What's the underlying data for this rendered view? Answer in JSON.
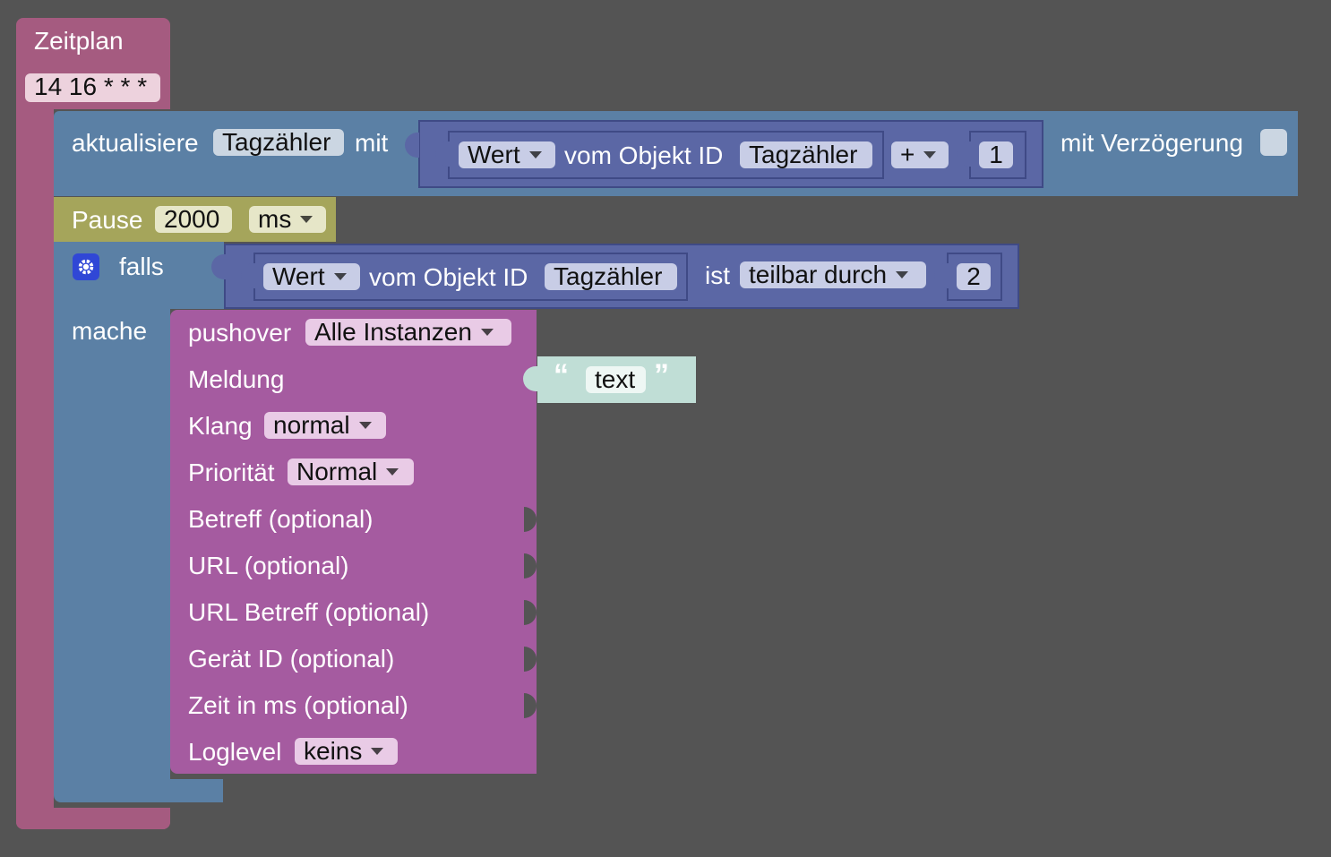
{
  "schedule": {
    "title": "Zeitplan",
    "cron": "14 16 * * *"
  },
  "update": {
    "label": "aktualisiere",
    "target": "Tagzähler",
    "with_label": "mit",
    "value_dropdown": "Wert",
    "of_object_label": "vom Objekt ID",
    "object_id": "Tagzähler",
    "operator": "+",
    "operand": "1",
    "delay_label": "mit Verzögerung"
  },
  "pause": {
    "label": "Pause",
    "amount": "2000",
    "unit": "ms"
  },
  "if_block": {
    "if_label": "falls",
    "value_dropdown": "Wert",
    "of_object_label": "vom Objekt ID",
    "object_id": "Tagzähler",
    "is_label": "ist",
    "condition": "teilbar durch",
    "operand": "2",
    "do_label": "mache"
  },
  "pushover": {
    "label": "pushover",
    "instance": "Alle Instanzen",
    "message_label": "Meldung",
    "message_text": "text",
    "sound_label": "Klang",
    "sound": "normal",
    "priority_label": "Priorität",
    "priority": "Normal",
    "subject_label": "Betreff (optional)",
    "url_label": "URL (optional)",
    "url_subject_label": "URL Betreff (optional)",
    "device_label": "Gerät ID (optional)",
    "time_label": "Zeit in ms (optional)",
    "loglevel_label": "Loglevel",
    "loglevel": "keins"
  },
  "colors": {
    "workspace": "#545454",
    "schedule_block": "#a55b80",
    "update_block": "#5b80a5",
    "object_block": "#5b67a5",
    "pause_block": "#a5a55b",
    "pushover_block": "#a55ba0",
    "text_block": "#c0ded6",
    "mutator_icon": "#3047d6"
  }
}
